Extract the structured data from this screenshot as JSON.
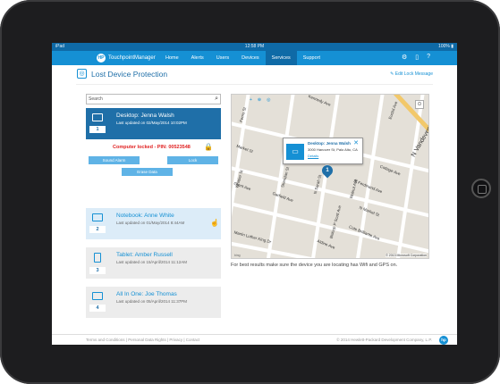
{
  "status": {
    "carrier": "iPad",
    "time": "12:58 PM",
    "battery": "100%"
  },
  "nav": {
    "brand_prefix": "HP",
    "brand": "TouchpointManager",
    "items": [
      "Home",
      "Alerts",
      "Users",
      "Devices",
      "Services",
      "Support"
    ],
    "active_index": 4
  },
  "page": {
    "title": "Lost Device Protection",
    "edit_lock_message": "Edit Lock Message"
  },
  "search": {
    "placeholder": "Search"
  },
  "devices": [
    {
      "name": "Desktop: Jenna Walsh",
      "updated": "Last updated on 02/May/2014 10:02PM",
      "number": "1"
    },
    {
      "name": "Notebook: Anne White",
      "updated": "Last updated on 01/May/2014 8:44AM",
      "number": "2"
    },
    {
      "name": "Tablet: Amber Russell",
      "updated": "Last updated on 15/April/2014 11:12AM",
      "number": "3"
    },
    {
      "name": "All In One: Joe Thomas",
      "updated": "Last updated on 05/April/2014 11:37PM",
      "number": "4"
    }
  ],
  "locked": {
    "message": "Computer locked - PIN: 00523548",
    "sound_alarm": "Sound Alarm",
    "lock": "Lock",
    "erase_data": "Erase Data"
  },
  "map": {
    "popup_name": "Desktop: Jenna Walsh",
    "popup_address": "3000 Hanover St, Palo Alto, CA",
    "popup_details": "Details",
    "pin_number": "1",
    "streets": [
      "Kennedy Ave",
      "Market St",
      "Grant Ave",
      "Garfield Ave",
      "Whittier St",
      "Ferris St",
      "Sheridan St",
      "N Sarah St",
      "Walnut Ave",
      "St Ferdinand Ave",
      "Cottage Ave",
      "N Market St",
      "Aldine Ave",
      "Cote Brilliante Ave",
      "Martin Luther King Dr",
      "Bishop P Scott Ave",
      "N Vandeventer Ave",
      "Euclid Ave"
    ],
    "copyright": "© 2013 Microsoft Corporation",
    "provider": "bing"
  },
  "hint": "For best results make sure the device you are locating has Wifi and GPS on.",
  "footer": {
    "left": "Terms and Conditions  |  Personal Data Rights  |  Privacy  |  Contact",
    "right": "© 2014 Hewlett-Packard Development Company, L.P.",
    "logo": "hp"
  },
  "colors": {
    "nav": "#1590d4",
    "nav_dark": "#0f6aa6",
    "selected": "#1f6fa8",
    "alert": "#e02020"
  }
}
